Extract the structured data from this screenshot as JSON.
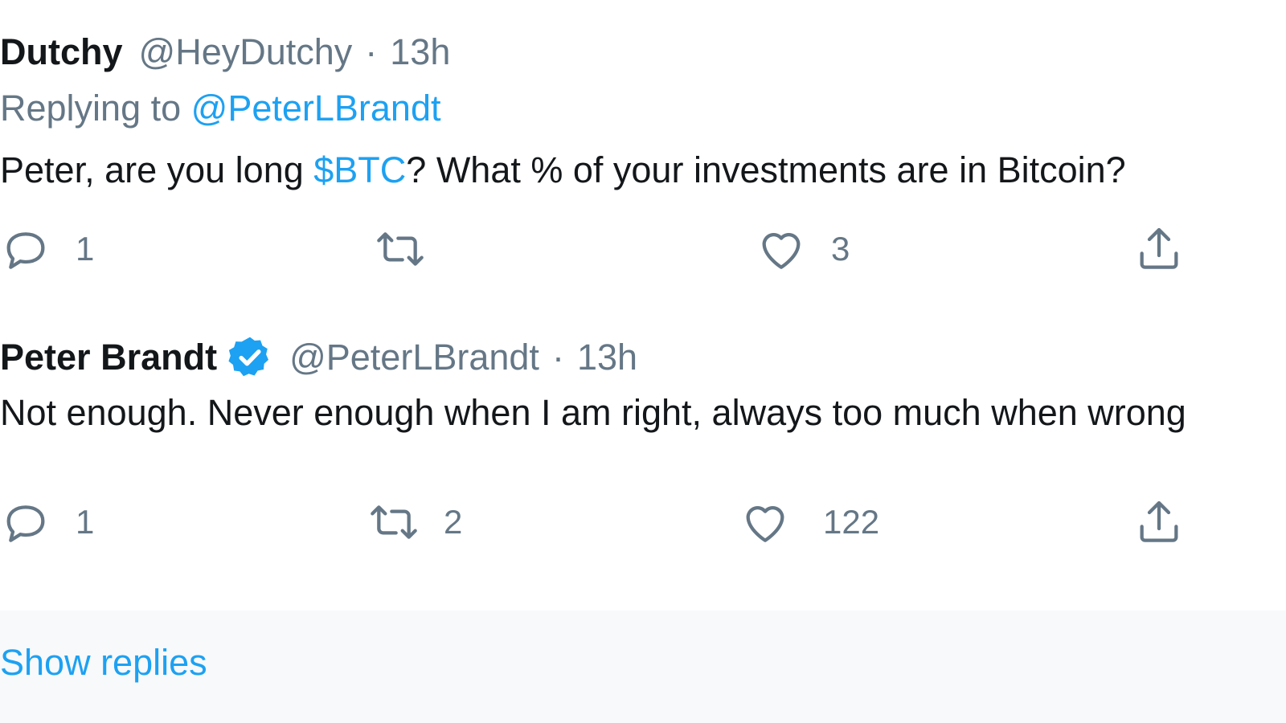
{
  "tweets": [
    {
      "name": "Dutchy",
      "handle": "@HeyDutchy",
      "separator": "·",
      "time": "13h",
      "replying_prefix": "Replying to ",
      "replying_to": "@PeterLBrandt",
      "text_before": "Peter, are you long ",
      "cashtag": "$BTC",
      "text_after": "? What % of your investments are in Bitcoin?",
      "reply_count": "1",
      "retweet_count": "",
      "like_count": "3",
      "verified": false
    },
    {
      "name": "Peter Brandt",
      "handle": "@PeterLBrandt",
      "separator": "·",
      "time": "13h",
      "text": "Not enough. Never enough when I am right, always too much when wrong",
      "reply_count": "1",
      "retweet_count": "2",
      "like_count": "122",
      "verified": true
    }
  ],
  "show_replies": "Show replies",
  "colors": {
    "link": "#1da1f2",
    "muted": "#657786",
    "text": "#14171a",
    "verified_badge": "#1da1f2",
    "footer_bg": "#f7f9fa"
  },
  "icons": [
    "reply-icon",
    "retweet-icon",
    "like-icon",
    "share-icon",
    "verified-badge-icon"
  ]
}
